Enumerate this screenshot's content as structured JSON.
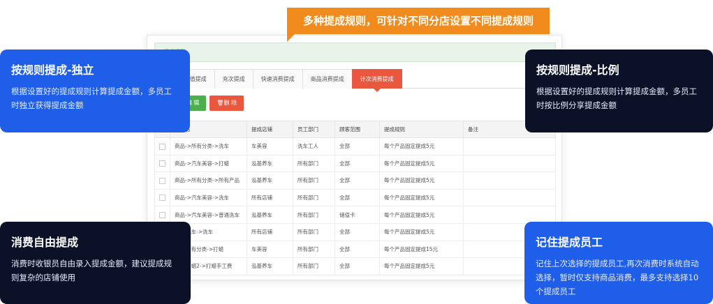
{
  "callout": {
    "text": "多种提成规则，可针对不同分店设置不同提成规则"
  },
  "panel": {
    "title": "提成规则",
    "tabs": [
      {
        "label": "...",
        "active": false
      },
      {
        "label": "充值提成",
        "active": false
      },
      {
        "label": "充次提成",
        "active": false
      },
      {
        "label": "快速消费提成",
        "active": false
      },
      {
        "label": "商品消费提成",
        "active": false
      },
      {
        "label": "计次消费提成",
        "active": true
      }
    ],
    "toolbar": {
      "edit_label": "✎编 辑",
      "delete_label": "🗑删 除"
    },
    "columns": [
      "...产品",
      "提成店铺",
      "员工部门",
      "顾客范围",
      "提成规则",
      "备注"
    ],
    "rows": [
      [
        "商品->所有分类->洗车",
        "车美容",
        "洗车工人",
        "全部",
        "每个产品固定提成5元",
        ""
      ],
      [
        "商品->汽车美容->打蜡",
        "泓基养车",
        "所有部门",
        "全部",
        "每个产品固定提成5元",
        ""
      ],
      [
        "商品->所有分类->所有产品",
        "泓基养车",
        "所有部门",
        "全部",
        "每个产品固定提成5元",
        ""
      ],
      [
        "商品->汽车美容->洗车",
        "所有店铺",
        "所有部门",
        "全部",
        "每个产品固定提成5元",
        ""
      ],
      [
        "商品->汽车美容->普通洗车",
        "泓基养车",
        "所有部门",
        "储值卡",
        "每个产品固定提成5元",
        ""
      ],
      [
        "...->洗车->洗车",
        "所有店铺",
        "所有部门",
        "全部",
        "每个产品固定提成5元",
        ""
      ],
      [
        "...->所有分类->打蜡",
        "车美容",
        "所有部门",
        "全部",
        "每个产品固定提成15元",
        ""
      ],
      [
        "...->打蜡2->打蜡手工费",
        "泓基养车",
        "所有部门",
        "全部",
        "每个产品固定提成5元",
        ""
      ]
    ]
  },
  "cards": {
    "c1": {
      "title": "按规则提成-独立",
      "desc": "根据设置好的提成规则计算提成金额，多员工时独立获得提成金额"
    },
    "c2": {
      "title": "按规则提成-比例",
      "desc": "根据设置好的提成规则计算提成金额，多员工时按比例分享提成金额"
    },
    "c3": {
      "title": "消费自由提成",
      "desc": "消费时收银员自由录入提成金额，建议提成规则复杂的店铺使用"
    },
    "c4": {
      "title": "记住提成员工",
      "desc": "记住上次选择的提成员工,再次消费时系统自动选择，暂时仅支持商品消费，最多支持选择10个提成员工"
    }
  },
  "colors": {
    "accent_orange": "#f28b1d",
    "card_blue": "#1e5ee8",
    "card_dark": "#0b1126",
    "tab_active": "#e9573f",
    "button_green": "#4cae4c"
  }
}
